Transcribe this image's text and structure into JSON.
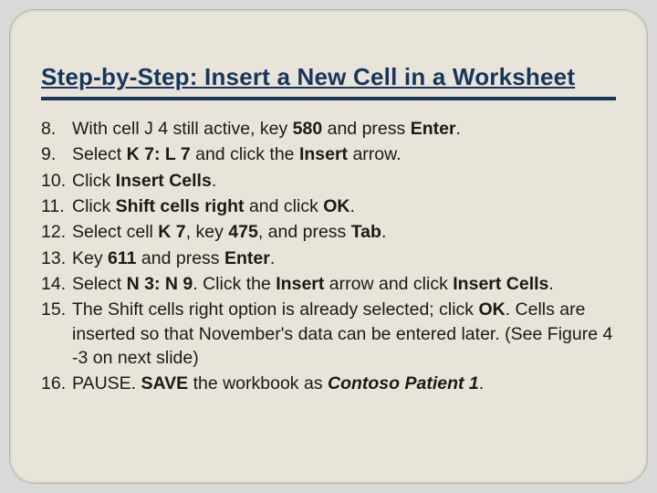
{
  "title": "Step-by-Step: Insert a New Cell in a Worksheet",
  "steps": [
    {
      "n": "8.",
      "html": "With cell J 4 still active, key <b>580</b> and press <b>Enter</b>."
    },
    {
      "n": "9.",
      "html": "Select <b>K 7: L 7</b> and click the <b>Insert</b> arrow."
    },
    {
      "n": "10.",
      "html": "Click <b>Insert Cells</b>."
    },
    {
      "n": "11.",
      "html": "Click <b>Shift cells right</b> and click <b>OK</b>."
    },
    {
      "n": "12.",
      "html": "Select cell <b>K 7</b>, key <b>475</b>, and press <b>Tab</b>."
    },
    {
      "n": "13.",
      "html": "Key <b>611</b> and press <b>Enter</b>."
    },
    {
      "n": "14.",
      "html": "Select <b>N 3: N 9</b>. Click the <b>Insert</b> arrow and click <b>Insert Cells</b>."
    },
    {
      "n": "15.",
      "html": "The Shift cells right option is already selected; click <b>OK</b>. Cells are inserted so that November's data can be entered later. (See Figure 4 -3 on next slide)"
    },
    {
      "n": "16.",
      "html": "PAUSE. <b>SAVE</b> the workbook as <b><i>Contoso Patient 1</i></b>."
    }
  ]
}
